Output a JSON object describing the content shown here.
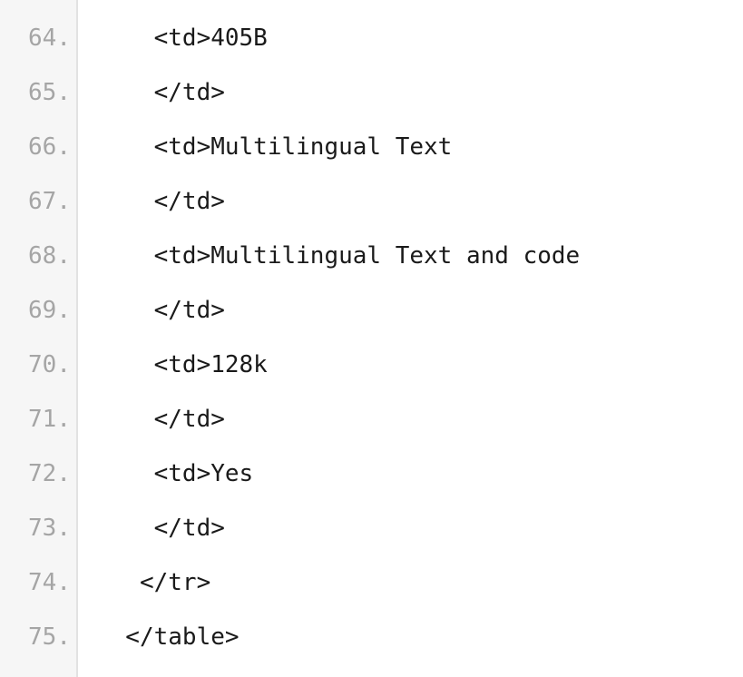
{
  "editor": {
    "language": "html",
    "gutter_bg": "#f6f6f6",
    "gutter_border": "#e2e2e2",
    "content_bg": "#ffffff",
    "line_number_color": "#a5a5a5",
    "code_color": "#1a1a1a",
    "line_number_suffix": ".",
    "first_visible_line": 64,
    "last_visible_line": 75
  },
  "lines": [
    {
      "number": "64.",
      "code": "    <td>405B"
    },
    {
      "number": "65.",
      "code": "    </td>"
    },
    {
      "number": "66.",
      "code": "    <td>Multilingual Text"
    },
    {
      "number": "67.",
      "code": "    </td>"
    },
    {
      "number": "68.",
      "code": "    <td>Multilingual Text and code"
    },
    {
      "number": "69.",
      "code": "    </td>"
    },
    {
      "number": "70.",
      "code": "    <td>128k"
    },
    {
      "number": "71.",
      "code": "    </td>"
    },
    {
      "number": "72.",
      "code": "    <td>Yes"
    },
    {
      "number": "73.",
      "code": "    </td>"
    },
    {
      "number": "74.",
      "code": "   </tr>"
    },
    {
      "number": "75.",
      "code": "  </table>"
    }
  ]
}
